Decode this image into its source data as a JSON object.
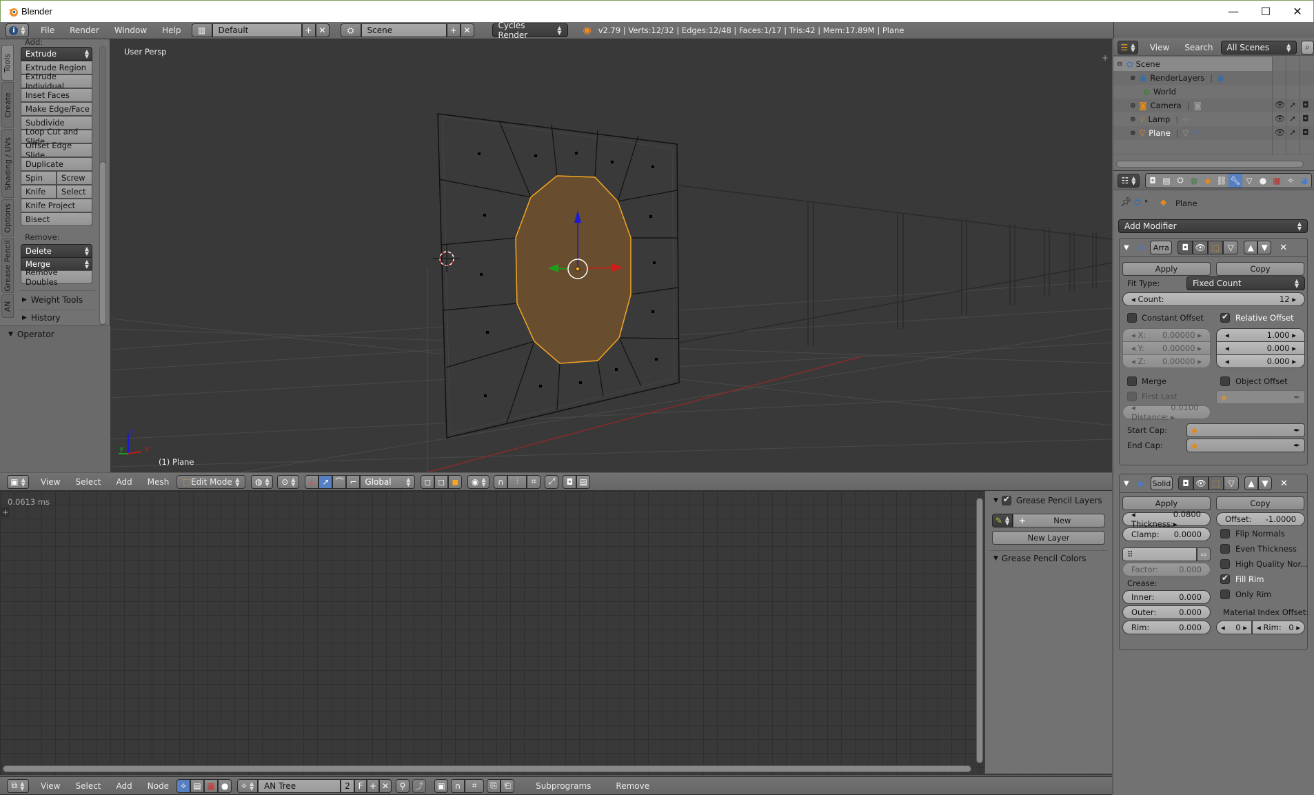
{
  "window": {
    "title": "Blender",
    "controls": [
      "minimize",
      "maximize",
      "close"
    ]
  },
  "info_header": {
    "menus": [
      "File",
      "Render",
      "Window",
      "Help"
    ],
    "screen_layout": "Default",
    "scene": "Scene",
    "render_engine": "Cycles Render",
    "stats": "v2.79 | Verts:12/32 | Edges:12/48 | Faces:1/17 | Tris:42 | Mem:17.89M | Plane"
  },
  "viewport": {
    "view_label": "User Persp",
    "object_label": "(1) Plane",
    "axis_labels": {
      "x": "x",
      "y": "y",
      "z": "z"
    },
    "colors": {
      "selection": "#f5a623",
      "face_fill": "#6b4e2e",
      "background": "#393939"
    }
  },
  "tool_shelf": {
    "tabs": [
      "Tools",
      "Create",
      "Shading / UVs",
      "Options",
      "Grease Pencil",
      "AN"
    ],
    "active_tab": "Tools",
    "add_label": "Add:",
    "add_dropdown": "Extrude",
    "add_buttons": [
      "Extrude Region",
      "Extrude Individual",
      "Inset Faces",
      "Make Edge/Face",
      "Subdivide",
      "Loop Cut and Slide",
      "Offset Edge Slide",
      "Duplicate"
    ],
    "pair_buttons": [
      [
        "Spin",
        "Screw"
      ],
      [
        "Knife",
        "Select"
      ]
    ],
    "more_buttons": [
      "Knife Project",
      "Bisect"
    ],
    "remove_label": "Remove:",
    "remove_dropdowns": [
      "Delete",
      "Merge"
    ],
    "remove_buttons": [
      "Remove Doubles"
    ],
    "panels": [
      "Weight Tools",
      "History"
    ],
    "operator_panel": "Operator"
  },
  "view3d_header": {
    "menus": [
      "View",
      "Select",
      "Add",
      "Mesh"
    ],
    "mode": "Edit Mode",
    "orientation": "Global"
  },
  "node_editor": {
    "timing": "0.0613 ms",
    "grease_pencil": {
      "layers_title": "Grease Pencil Layers",
      "layers_enabled": true,
      "new_label": "New",
      "new_layer_label": "New Layer",
      "colors_title": "Grease Pencil Colors"
    }
  },
  "node_header": {
    "menus": [
      "View",
      "Select",
      "Add",
      "Node"
    ],
    "tree_name": "AN Tree",
    "users": "2",
    "fake_user": "F",
    "buttons": [
      "Subprograms",
      "Remove"
    ]
  },
  "outliner": {
    "menus": [
      "View",
      "Search"
    ],
    "filter": "All Scenes",
    "items": [
      {
        "name": "Scene",
        "icon": "scene-icon",
        "level": 0
      },
      {
        "name": "RenderLayers",
        "icon": "render-layers-icon",
        "level": 1
      },
      {
        "name": "World",
        "icon": "world-icon",
        "level": 1
      },
      {
        "name": "Camera",
        "icon": "camera-icon",
        "level": 1
      },
      {
        "name": "Lamp",
        "icon": "lamp-icon",
        "level": 1
      },
      {
        "name": "Plane",
        "icon": "mesh-icon",
        "level": 1
      }
    ]
  },
  "properties": {
    "breadcrumb": "Plane",
    "add_modifier": "Add Modifier",
    "array_modifier": {
      "name": "Arra",
      "apply": "Apply",
      "copy": "Copy",
      "fit_type_label": "Fit Type:",
      "fit_type": "Fixed Count",
      "count_label": "Count:",
      "count": "12",
      "constant_offset_label": "Constant Offset",
      "constant_offset": false,
      "relative_offset_label": "Relative Offset",
      "relative_offset": true,
      "constant_xyz": [
        {
          "label": "X:",
          "value": "0.00000"
        },
        {
          "label": "Y:",
          "value": "0.00000"
        },
        {
          "label": "Z:",
          "value": "0.00000"
        }
      ],
      "relative_xyz": [
        "1.000",
        "0.000",
        "0.000"
      ],
      "merge_label": "Merge",
      "merge": false,
      "object_offset_label": "Object Offset",
      "object_offset": false,
      "first_last_label": "First Last",
      "distance_label": "Distance:",
      "distance": "0.0100",
      "start_cap_label": "Start Cap:",
      "end_cap_label": "End Cap:"
    },
    "solidify_modifier": {
      "name": "Solid",
      "apply": "Apply",
      "copy": "Copy",
      "thickness_label": "Thickness:",
      "thickness": "0.0800",
      "offset_label": "Offset:",
      "offset": "-1.0000",
      "clamp_label": "Clamp:",
      "clamp": "0.0000",
      "factor_label": "Factor:",
      "factor": "0.000",
      "crease_label": "Crease:",
      "inner_label": "Inner:",
      "inner": "0.000",
      "outer_label": "Outer:",
      "outer": "0.000",
      "rim_label": "Rim:",
      "rim": "0.000",
      "flags": [
        {
          "label": "Flip Normals",
          "checked": false
        },
        {
          "label": "Even Thickness",
          "checked": false
        },
        {
          "label": "High Quality Nor...",
          "checked": false
        },
        {
          "label": "Fill Rim",
          "checked": true
        },
        {
          "label": "Only Rim",
          "checked": false
        }
      ],
      "material_index_label": "Material Index Offset:",
      "material_index": "0",
      "material_rim_label": "Rim:",
      "material_rim": "0"
    }
  }
}
